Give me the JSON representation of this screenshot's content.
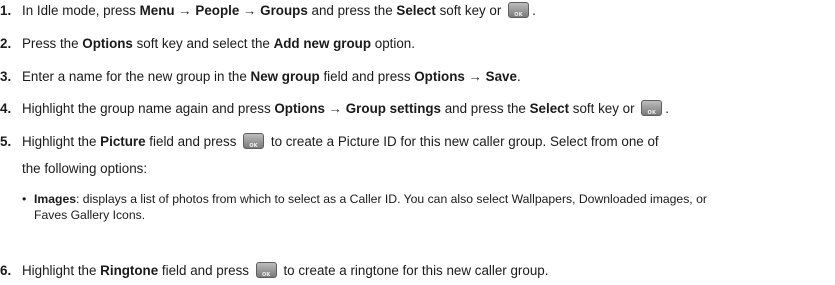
{
  "steps": [
    {
      "num": "1.",
      "parts": [
        "In Idle mode, press ",
        "Menu",
        " → ",
        "People",
        " → ",
        "Groups",
        " and press the ",
        "Select",
        " soft key or ",
        "."
      ]
    },
    {
      "num": "2.",
      "parts": [
        "Press the ",
        "Options",
        " soft key and select the ",
        "Add new group",
        " option."
      ]
    },
    {
      "num": "3.",
      "parts": [
        "Enter a name for the new group in the ",
        "New group",
        " field and press ",
        "Options → Save",
        "."
      ]
    },
    {
      "num": "4.",
      "parts": [
        "Highlight the group name again and press ",
        "Options → Group settings",
        " and press the ",
        "Select",
        " soft key or ",
        "."
      ]
    },
    {
      "num": "5.",
      "parts": [
        "Highlight the ",
        "Picture",
        " field and press ",
        " to create a Picture ID for this new caller group. Select from one of",
        "the following options:"
      ]
    },
    {
      "num": "6.",
      "parts": [
        "Highlight the ",
        "Ringtone",
        " field and press ",
        " to create a ringtone for this new caller group."
      ]
    }
  ],
  "bullet": {
    "term": "Images",
    "text": ": displays a list of photos from which to select as a Caller ID. You can also select Wallpapers, Downloaded images, or",
    "text2": "Faves Gallery Icons."
  },
  "icon": "ok-key-icon",
  "colors": {
    "text": "#1a1a1a",
    "ok_key": "#8a8a8a"
  }
}
